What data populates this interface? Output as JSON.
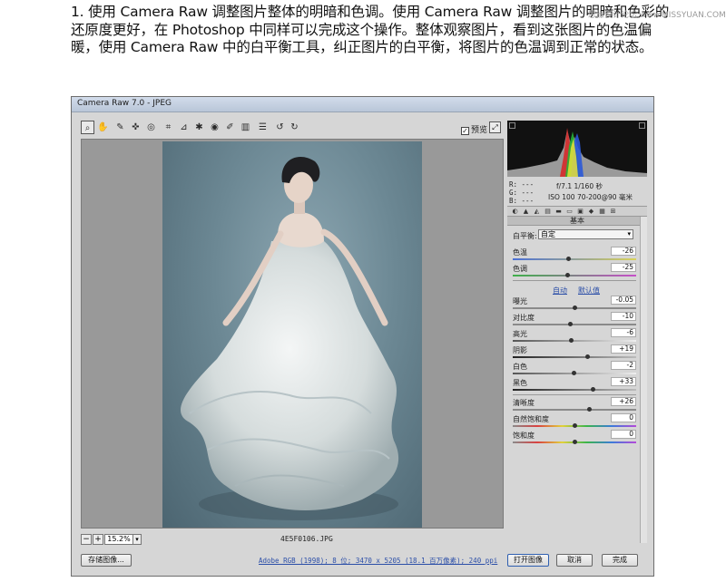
{
  "intro": {
    "text": "1. 使用 Camera Raw 调整图片整体的明暗和色调。使用 Camera Raw 调整图片的明暗和色彩的还原度更好，在 Photoshop 中同样可以完成这个操作。整体观察图片，看到这张图片的色温偏暖，使用 Camera Raw 中的白平衡工具，纠正图片的白平衡，将图片的色温调到正常的状态。",
    "watermark": "思缘设计论坛 www.MISSYUAN.COM"
  },
  "window": {
    "title": "Camera Raw 7.0 - JPEG",
    "preview_label": "预览",
    "preview_checked": "✓"
  },
  "toolbar": {
    "icons": [
      "zoom-icon",
      "hand-icon",
      "white-balance-icon",
      "color-sampler-icon",
      "target-adjust-icon",
      "crop-icon",
      "straighten-icon",
      "spot-removal-icon",
      "red-eye-icon",
      "adjustment-brush-icon",
      "graduated-filter-icon",
      "preferences-icon",
      "rotate-ccw-icon",
      "rotate-cw-icon"
    ],
    "glyphs": [
      "⌕",
      "✋",
      "✎",
      "✜",
      "◎",
      "⌗",
      "⊿",
      "✱",
      "◉",
      "✐",
      "▥",
      "☰",
      "↺",
      "↻"
    ]
  },
  "zoom": {
    "minus": "−",
    "plus": "+",
    "value": "15.2%",
    "dropdown": "▾"
  },
  "file": {
    "name": "4E5F0106.JPG"
  },
  "info": {
    "rgb_r": "R:  ---",
    "rgb_g": "G:  ---",
    "rgb_b": "B:  ---",
    "exposure_line": "f/7.1  1/160 秒",
    "lens_line": "ISO 100  70-200@90 毫米"
  },
  "panel": {
    "title": "基本",
    "tab_glyphs": [
      "◐",
      "▲",
      "◭",
      "▤",
      "▬",
      "▭",
      "▣",
      "◆",
      "▦",
      "⊞"
    ],
    "white_balance_label": "白平衡:",
    "white_balance_value": "自定",
    "dropdown_glyph": "▾",
    "auto_label": "自动",
    "default_label": "默认值",
    "sliders_wb": [
      {
        "key": "temperature",
        "label": "色温",
        "value": "-26",
        "position": 0.45
      },
      {
        "key": "tint",
        "label": "色调",
        "value": "-25",
        "position": 0.44
      }
    ],
    "sliders_tone": [
      {
        "key": "exposure",
        "label": "曝光",
        "value": "-0.05",
        "position": 0.5
      },
      {
        "key": "contrast",
        "label": "对比度",
        "value": "-10",
        "position": 0.46
      },
      {
        "key": "highlights",
        "label": "高光",
        "value": "-6",
        "position": 0.47
      },
      {
        "key": "shadows",
        "label": "阴影",
        "value": "+19",
        "position": 0.6
      },
      {
        "key": "whites",
        "label": "白色",
        "value": "-2",
        "position": 0.49
      },
      {
        "key": "blacks",
        "label": "黑色",
        "value": "+33",
        "position": 0.65
      }
    ],
    "sliders_presence": [
      {
        "key": "clarity",
        "label": "清晰度",
        "value": "+26",
        "position": 0.62
      },
      {
        "key": "vibrance",
        "label": "自然饱和度",
        "value": "0",
        "position": 0.5
      },
      {
        "key": "saturation",
        "label": "饱和度",
        "value": "0",
        "position": 0.5
      }
    ]
  },
  "status": {
    "save_label": "存储图像...",
    "workflow_text": "Adobe RGB (1998); 8 位; 3470 x 5205 (18.1 百万像素); 240 ppi",
    "open_label": "打开图像",
    "cancel_label": "取消",
    "done_label": "完成"
  },
  "colors": {
    "link": "#2b4ea8",
    "title_bar": "#c4cfe0",
    "canvas_bg": "#999999"
  }
}
